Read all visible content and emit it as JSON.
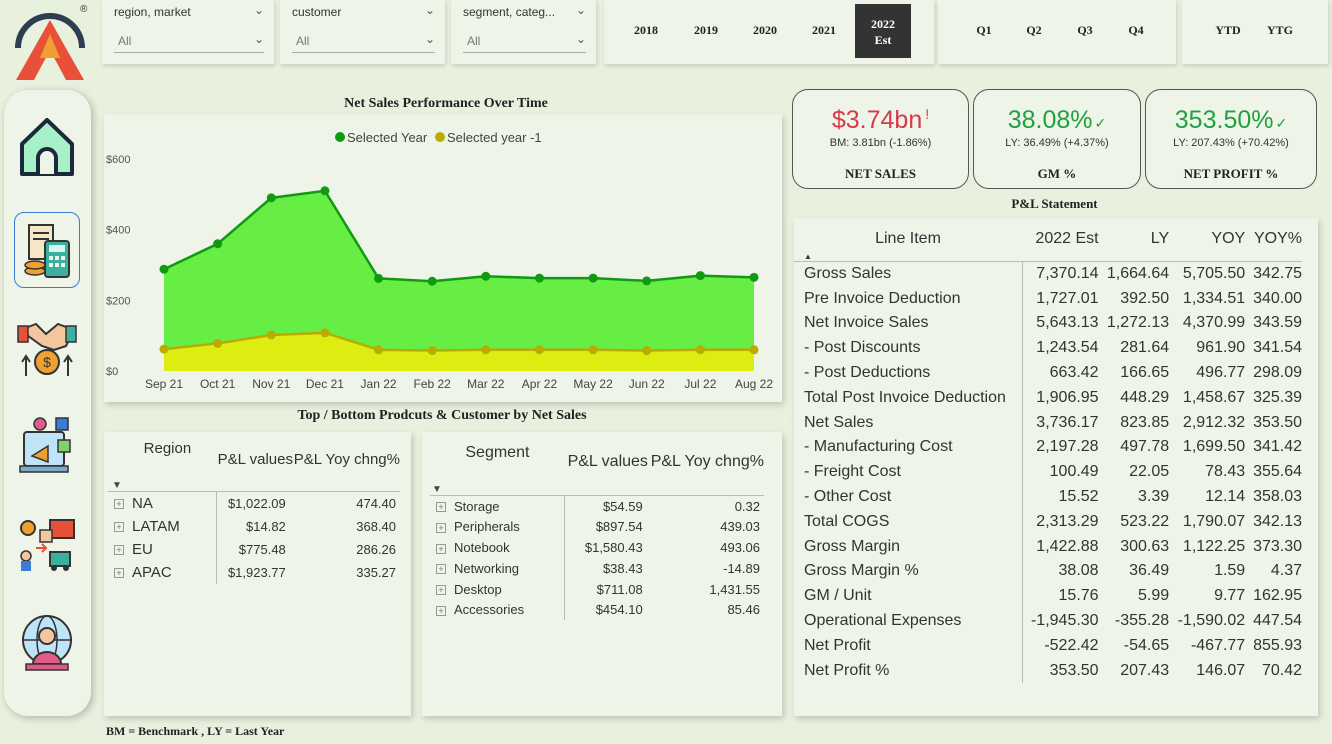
{
  "slicers": [
    {
      "title": "region, market",
      "value": "All"
    },
    {
      "title": "customer",
      "value": "All"
    },
    {
      "title": "segment, categ...",
      "value": "All"
    }
  ],
  "years": [
    "2018",
    "2019",
    "2020",
    "2021"
  ],
  "year_selected": {
    "line1": "2022",
    "line2": "Est"
  },
  "quarters": [
    "Q1",
    "Q2",
    "Q3",
    "Q4"
  ],
  "ytd": [
    "YTD",
    "YTG"
  ],
  "logo_mark": "®",
  "nav_icons": [
    "home-icon",
    "calculator-finance-icon",
    "handshake-money-icon",
    "marketing-icon",
    "supply-chain-icon",
    "customer-support-icon"
  ],
  "chart": {
    "title": "Net Sales Performance Over Time",
    "legend": [
      "Selected Year",
      "Selected year -1"
    ]
  },
  "chart_data": {
    "type": "area",
    "categories": [
      "Sep 21",
      "Oct 21",
      "Nov 21",
      "Dec 21",
      "Jan 22",
      "Feb 22",
      "Mar 22",
      "Apr 22",
      "May 22",
      "Jun 22",
      "Jul 22",
      "Aug 22"
    ],
    "series": [
      {
        "name": "Selected Year",
        "values": [
          288,
          360,
          490,
          510,
          262,
          254,
          268,
          263,
          263,
          255,
          270,
          265
        ],
        "color": "#119911",
        "fill": "#66ee44"
      },
      {
        "name": "Selected year -1",
        "values": [
          62,
          78,
          102,
          108,
          60,
          58,
          60,
          60,
          60,
          58,
          60,
          60
        ],
        "color": "#bbaa00",
        "fill": "#dded11"
      }
    ],
    "y_ticks": [
      "$0",
      "$200",
      "$400",
      "$600"
    ],
    "ylim": [
      0,
      600
    ]
  },
  "kpis": [
    {
      "value": "$3.74bn",
      "mark": "!",
      "sub": "BM: 3.81bn (-1.86%)",
      "label": "NET SALES",
      "color": "#d9384a"
    },
    {
      "value": "38.08%",
      "mark": "✓",
      "sub": "LY: 36.49% (+4.37%)",
      "label": "GM %",
      "color": "#22a040"
    },
    {
      "value": "353.50%",
      "mark": "✓",
      "sub": "LY: 207.43% (+70.42%)",
      "label": "NET PROFIT %",
      "color": "#22a040"
    }
  ],
  "pl": {
    "title": "P&L Statement",
    "headers": [
      "Line Item",
      "2022 Est",
      "LY",
      "YOY",
      "YOY%"
    ],
    "rows": [
      [
        "Gross Sales",
        "7,370.14",
        "1,664.64",
        "5,705.50",
        "342.75"
      ],
      [
        "Pre Invoice Deduction",
        "1,727.01",
        "392.50",
        "1,334.51",
        "340.00"
      ],
      [
        "Net Invoice Sales",
        "5,643.13",
        "1,272.13",
        "4,370.99",
        "343.59"
      ],
      [
        "- Post Discounts",
        "1,243.54",
        "281.64",
        "961.90",
        "341.54"
      ],
      [
        "- Post Deductions",
        "663.42",
        "166.65",
        "496.77",
        "298.09"
      ],
      [
        "Total Post Invoice Deduction",
        "1,906.95",
        "448.29",
        "1,458.67",
        "325.39"
      ],
      [
        "Net Sales",
        "3,736.17",
        "823.85",
        "2,912.32",
        "353.50"
      ],
      [
        "- Manufacturing Cost",
        "2,197.28",
        "497.78",
        "1,699.50",
        "341.42"
      ],
      [
        "- Freight Cost",
        "100.49",
        "22.05",
        "78.43",
        "355.64"
      ],
      [
        "- Other Cost",
        "15.52",
        "3.39",
        "12.14",
        "358.03"
      ],
      [
        "Total COGS",
        "2,313.29",
        "523.22",
        "1,790.07",
        "342.13"
      ],
      [
        "Gross Margin",
        "1,422.88",
        "300.63",
        "1,122.25",
        "373.30"
      ],
      [
        "Gross Margin %",
        "38.08",
        "36.49",
        "1.59",
        "4.37"
      ],
      [
        "GM / Unit",
        "15.76",
        "5.99",
        "9.77",
        "162.95"
      ],
      [
        "Operational Expenses",
        "-1,945.30",
        "-355.28",
        "-1,590.02",
        "447.54"
      ],
      [
        "Net Profit",
        "-522.42",
        "-54.65",
        "-467.77",
        "855.93"
      ],
      [
        "Net Profit %",
        "353.50",
        "207.43",
        "146.07",
        "70.42"
      ]
    ]
  },
  "topbottom": {
    "title": "Top / Bottom Prodcuts & Customer by Net Sales",
    "region": {
      "headers": [
        "Region",
        "P&L values",
        "P&L Yoy chng%"
      ],
      "rows": [
        [
          "NA",
          "$1,022.09",
          "474.40"
        ],
        [
          "LATAM",
          "$14.82",
          "368.40"
        ],
        [
          "EU",
          "$775.48",
          "286.26"
        ],
        [
          "APAC",
          "$1,923.77",
          "335.27"
        ]
      ]
    },
    "segment": {
      "headers": [
        "Segment",
        "P&L values",
        "P&L Yoy chng%"
      ],
      "rows": [
        [
          "Storage",
          "$54.59",
          "0.32"
        ],
        [
          "Peripherals",
          "$897.54",
          "439.03"
        ],
        [
          "Notebook",
          "$1,580.43",
          "493.06"
        ],
        [
          "Networking",
          "$38.43",
          "-14.89"
        ],
        [
          "Desktop",
          "$711.08",
          "1,431.55"
        ],
        [
          "Accessories",
          "$454.10",
          "85.46"
        ]
      ]
    }
  },
  "footnote": "BM = Benchmark ,  LY = Last Year"
}
